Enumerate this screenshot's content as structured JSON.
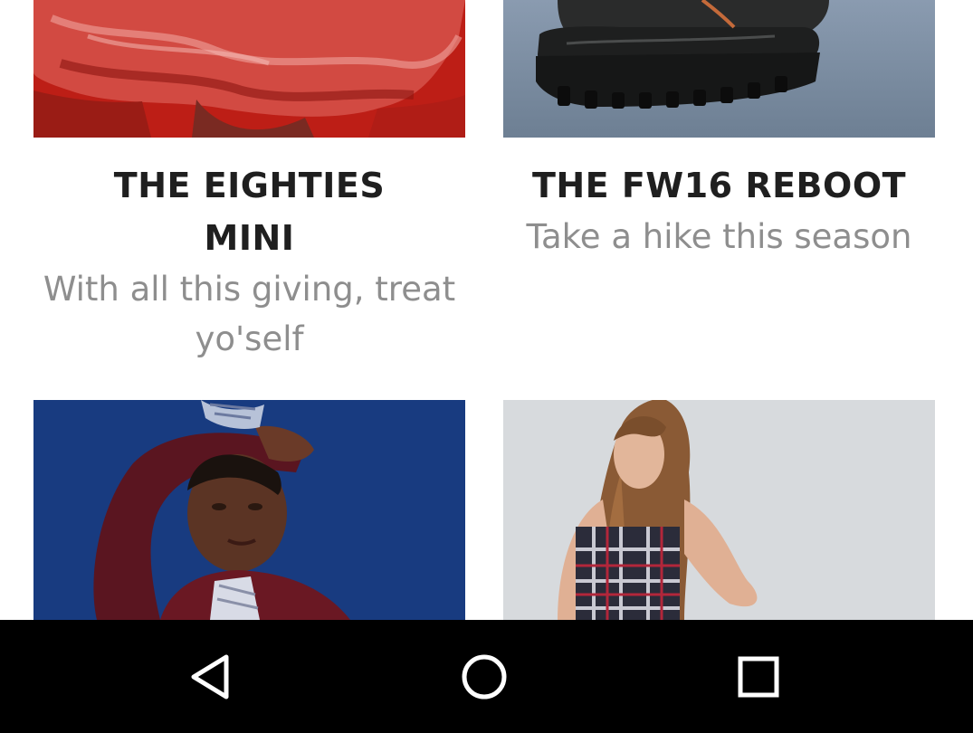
{
  "cards": [
    {
      "title_line1": "THE EIGHTIES",
      "title_line2": "MINI",
      "subtitle_line1": "With all this giving, treat",
      "subtitle_line2": "yo'self"
    },
    {
      "title_line1": "THE FW16 REBOOT",
      "subtitle_line1": "Take a hike this season"
    }
  ],
  "colors": {
    "title": "#1f1f1f",
    "subtitle": "#8e8e8e",
    "navbar": "#000000"
  },
  "nav": {
    "back_icon": "triangle-back-icon",
    "home_icon": "circle-home-icon",
    "recents_icon": "square-recents-icon"
  }
}
